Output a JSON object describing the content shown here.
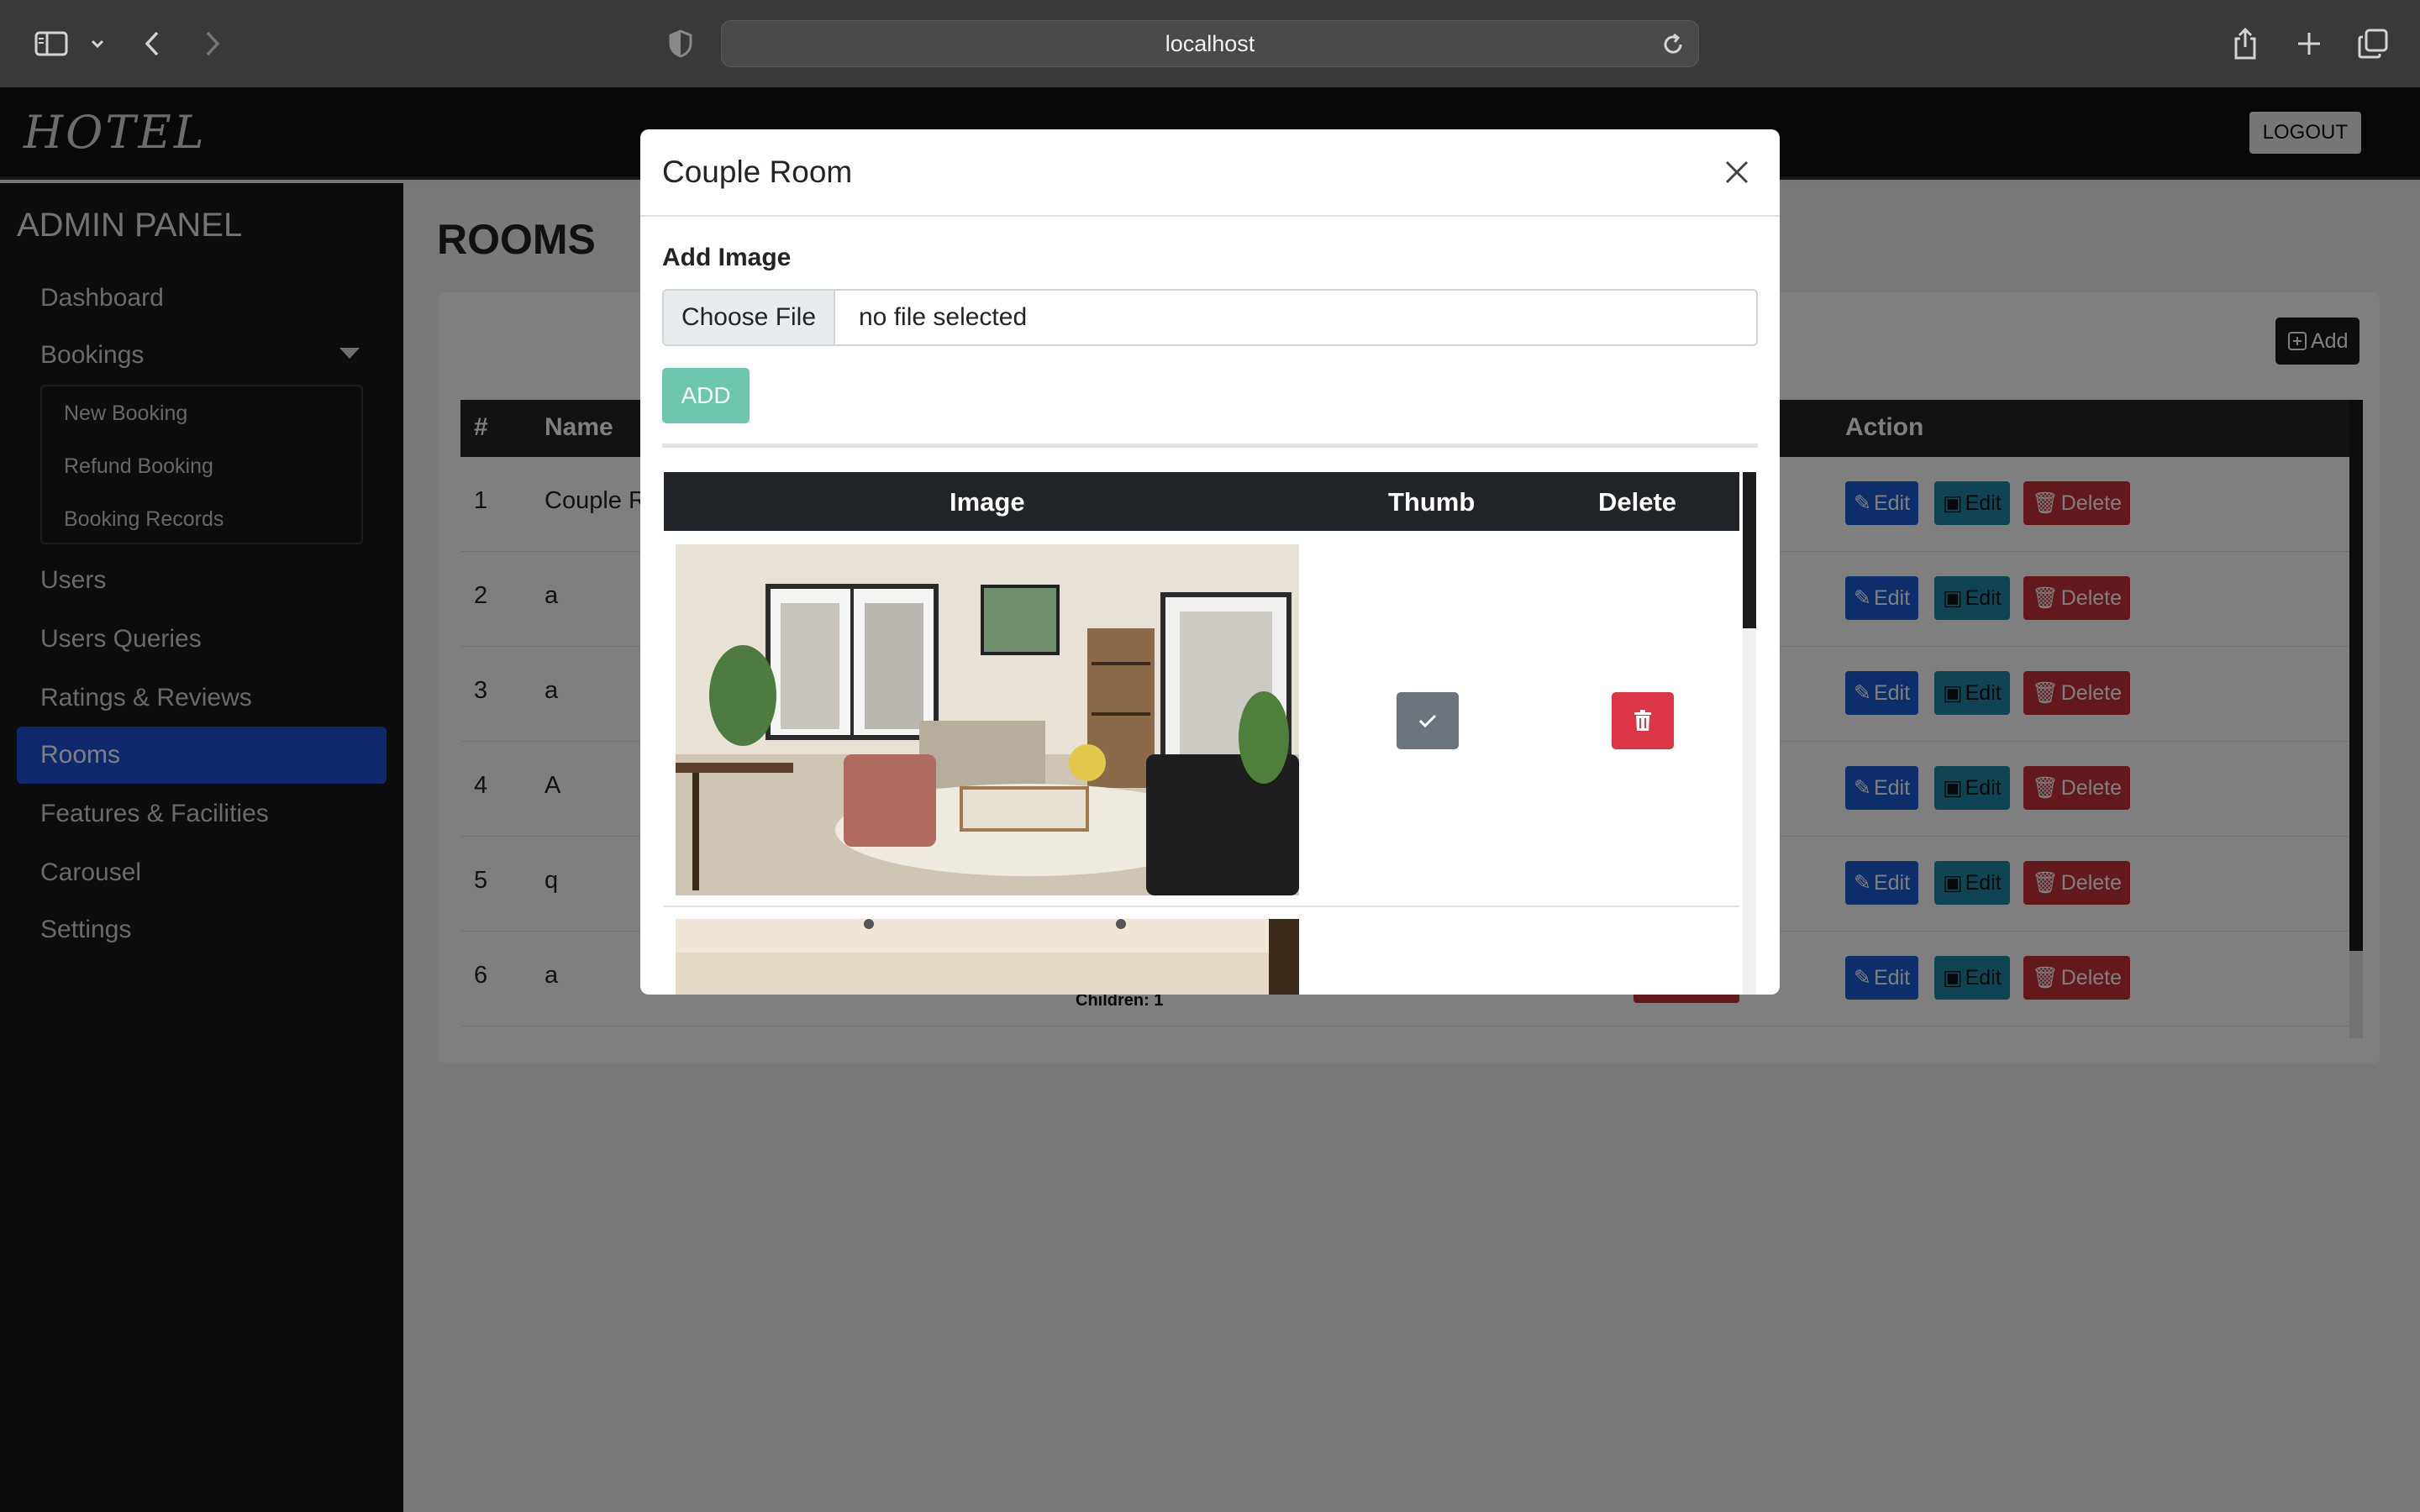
{
  "browser": {
    "url": "localhost"
  },
  "header": {
    "brand": "HOTEL",
    "logout_label": "LOGOUT"
  },
  "sidebar": {
    "title": "ADMIN PANEL",
    "items": [
      {
        "label": "Dashboard"
      },
      {
        "label": "Bookings"
      },
      {
        "label": "Users"
      },
      {
        "label": "Users Queries"
      },
      {
        "label": "Ratings & Reviews"
      },
      {
        "label": "Rooms"
      },
      {
        "label": "Features & Facilities"
      },
      {
        "label": "Carousel"
      },
      {
        "label": "Settings"
      }
    ],
    "bookings_sub": [
      {
        "label": "New Booking"
      },
      {
        "label": "Refund Booking"
      },
      {
        "label": "Booking Records"
      }
    ],
    "active": "Rooms"
  },
  "main": {
    "title": "ROOMS",
    "add_label": "Add",
    "table": {
      "headers": {
        "num": "#",
        "name": "Name",
        "action": "Action"
      },
      "rows": [
        {
          "num": "1",
          "name": "Couple R"
        },
        {
          "num": "2",
          "name": "a"
        },
        {
          "num": "3",
          "name": "a"
        },
        {
          "num": "4",
          "name": "A"
        },
        {
          "num": "5",
          "name": "q"
        },
        {
          "num": "6",
          "name": "a"
        }
      ],
      "edit_label": "Edit",
      "image_edit_label": "Edit",
      "delete_label": "Delete",
      "children_text": "Children: 1"
    }
  },
  "modal": {
    "title": "Couple Room",
    "add_image_label": "Add Image",
    "choose_file_label": "Choose File",
    "file_status": "no file selected",
    "add_button": "ADD",
    "table_headers": {
      "image": "Image",
      "thumb": "Thumb",
      "delete": "Delete"
    }
  },
  "colors": {
    "accent": "#1f4fd6",
    "edit": "#1d5ad6",
    "image_edit": "#1f8aa6",
    "delete": "#c6303c",
    "add_teal": "#6cc7ae",
    "thumb_gray": "#6c757d"
  }
}
